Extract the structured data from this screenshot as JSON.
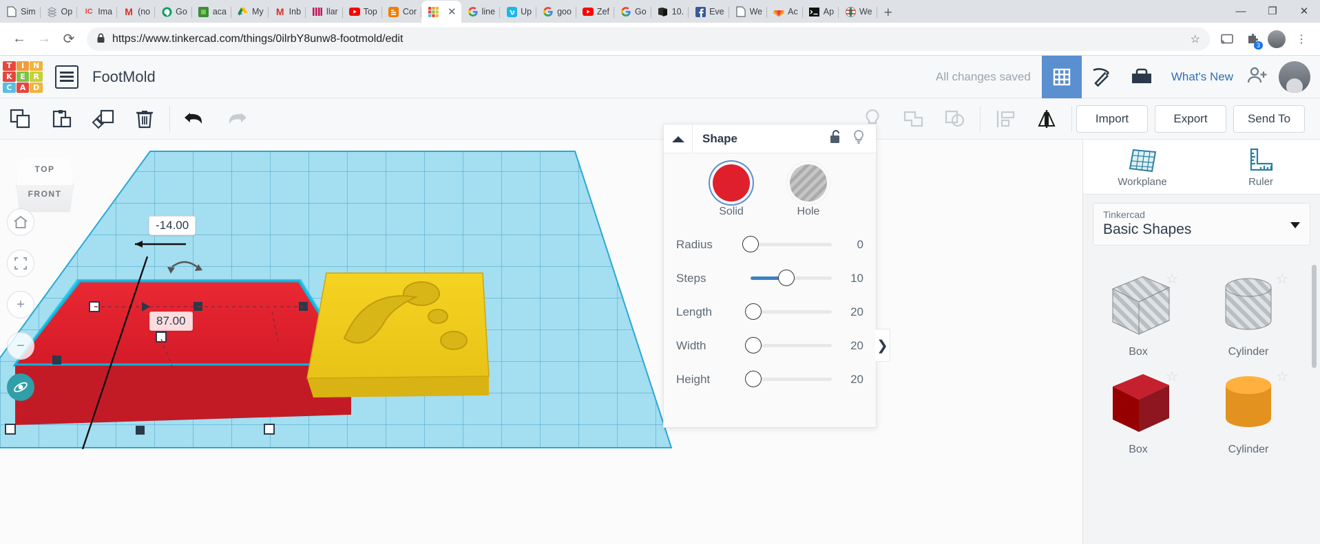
{
  "browser": {
    "tabs": [
      {
        "label": "Sim",
        "icon": "page-icon"
      },
      {
        "label": "Op",
        "icon": "layers-icon"
      },
      {
        "label": "Ima",
        "icon": "ic-icon"
      },
      {
        "label": "(no",
        "icon": "gmail-icon"
      },
      {
        "label": "Go",
        "icon": "hangouts-icon"
      },
      {
        "label": "aca",
        "icon": "puzzle-icon"
      },
      {
        "label": "My",
        "icon": "drive-icon"
      },
      {
        "label": "Inb",
        "icon": "gmail-icon"
      },
      {
        "label": "llar",
        "icon": "bars-icon"
      },
      {
        "label": "Top",
        "icon": "youtube-icon"
      },
      {
        "label": "Cor",
        "icon": "blogger-icon"
      },
      {
        "label": "",
        "icon": "tinkercad-icon",
        "active": true
      },
      {
        "label": "line",
        "icon": "google-icon"
      },
      {
        "label": "Up",
        "icon": "vimeo-icon"
      },
      {
        "label": "goo",
        "icon": "google-icon"
      },
      {
        "label": "Zef",
        "icon": "youtube-icon"
      },
      {
        "label": "Go",
        "icon": "google-icon"
      },
      {
        "label": "10.",
        "icon": "book-icon"
      },
      {
        "label": "Eve",
        "icon": "facebook-icon"
      },
      {
        "label": "We",
        "icon": "page-icon"
      },
      {
        "label": "Ac",
        "icon": "gitlab-icon"
      },
      {
        "label": "Ap",
        "icon": "terminal-icon"
      },
      {
        "label": "We",
        "icon": "globe-icon"
      }
    ],
    "tab_close_label": "✕",
    "new_tab_label": "+",
    "window_controls": [
      "—",
      "❐",
      "✕"
    ],
    "back_label": "←",
    "forward_label": "→",
    "reload_label": "⟳",
    "lock_label": "🔒",
    "url": "https://www.tinkercad.com/things/0ilrbY8unw8-footmold/edit",
    "star_label": "☆",
    "extension_badge": "3"
  },
  "header": {
    "logo_letters": [
      "T",
      "I",
      "N",
      "K",
      "E",
      "R",
      "C",
      "A",
      "D"
    ],
    "logo_colors": [
      "#e8453c",
      "#f29c3a",
      "#f2b33a",
      "#e8453c",
      "#7fc242",
      "#c3d234",
      "#5bbde0",
      "#e8453c",
      "#f2b33a"
    ],
    "document_name": "FootMold",
    "save_status": "All changes saved",
    "whats_new": "What's New",
    "grid_view_icon": "grid-icon",
    "edit_view_icon": "pickaxe-icon",
    "blocks_view_icon": "blocks-icon",
    "add_user_icon": "add-user-icon",
    "avatar_icon": "avatar"
  },
  "toolbar": {
    "left_buttons": [
      {
        "name": "copy-button",
        "icon": "copy-icon",
        "enabled": true
      },
      {
        "name": "paste-button",
        "icon": "paste-icon",
        "enabled": true
      },
      {
        "name": "duplicate-button",
        "icon": "duplicate-icon",
        "enabled": true
      },
      {
        "name": "delete-button",
        "icon": "trash-icon",
        "enabled": true
      },
      {
        "name": "undo-button",
        "icon": "undo-icon",
        "enabled": true
      },
      {
        "name": "redo-button",
        "icon": "redo-icon",
        "enabled": false
      }
    ],
    "right_buttons": [
      {
        "name": "light-button",
        "icon": "lightbulb-icon",
        "enabled": false
      },
      {
        "name": "group-button",
        "icon": "group-icon",
        "enabled": false
      },
      {
        "name": "ungroup-button",
        "icon": "ungroup-icon",
        "enabled": false
      },
      {
        "name": "align-button",
        "icon": "align-icon",
        "enabled": false
      },
      {
        "name": "mirror-button",
        "icon": "mirror-icon",
        "enabled": true
      }
    ],
    "import_label": "Import",
    "export_label": "Export",
    "send_to_label": "Send To"
  },
  "viewport": {
    "view_cube_top": "TOP",
    "view_cube_front": "FRONT",
    "home_icon": "home-icon",
    "fit_icon": "fit-to-view-icon",
    "zoom_in_label": "+",
    "zoom_out_label": "−",
    "orbit_icon": "orbit-icon",
    "measurement_offset": "-14.00",
    "measurement_length": "87.00",
    "selected_shape_color": "#e01f2d",
    "second_shape_color": "#e8c21a",
    "workplane_color": "#86d2ec"
  },
  "shape_panel": {
    "title": "Shape",
    "collapse_icon": "chevron-up-icon",
    "lock_icon": "unlock-icon",
    "light_icon": "lightbulb-icon",
    "solid_label": "Solid",
    "hole_label": "Hole",
    "solid_color": "#e01f2d",
    "parameters": [
      {
        "label": "Radius",
        "value": "0",
        "fill": 0
      },
      {
        "label": "Steps",
        "value": "10",
        "fill": 44
      },
      {
        "label": "Length",
        "value": "20",
        "fill": 3
      },
      {
        "label": "Width",
        "value": "20",
        "fill": 3
      },
      {
        "label": "Height",
        "value": "20",
        "fill": 3
      }
    ],
    "flap_label": "❯"
  },
  "sidebar": {
    "workplane_label": "Workplane",
    "ruler_label": "Ruler",
    "library_owner": "Tinkercad",
    "library_name": "Basic Shapes",
    "shapes": [
      {
        "label": "Box",
        "kind": "box-hole",
        "color": "#c9cdd2"
      },
      {
        "label": "Cylinder",
        "kind": "cylinder-hole",
        "color": "#c9cdd2"
      },
      {
        "label": "Box",
        "kind": "box-solid",
        "color": "#c4202e"
      },
      {
        "label": "Cylinder",
        "kind": "cylinder-solid",
        "color": "#e3911f"
      }
    ],
    "star_glyph": "☆"
  }
}
